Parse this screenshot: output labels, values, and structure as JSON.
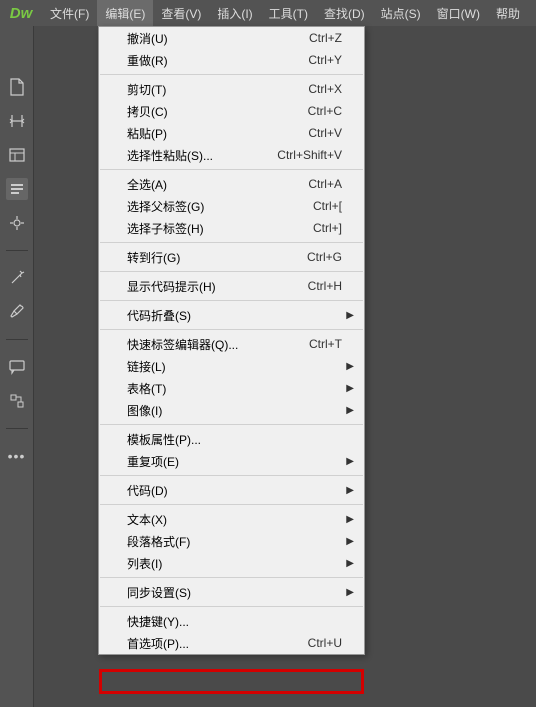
{
  "logo": "Dw",
  "menubar": [
    "文件(F)",
    "编辑(E)",
    "查看(V)",
    "插入(I)",
    "工具(T)",
    "查找(D)",
    "站点(S)",
    "窗口(W)",
    "帮助"
  ],
  "active_menu_index": 1,
  "dropdown": {
    "groups": [
      [
        {
          "label": "撤消(U)",
          "shortcut": "Ctrl+Z"
        },
        {
          "label": "重做(R)",
          "shortcut": "Ctrl+Y"
        }
      ],
      [
        {
          "label": "剪切(T)",
          "shortcut": "Ctrl+X"
        },
        {
          "label": "拷贝(C)",
          "shortcut": "Ctrl+C"
        },
        {
          "label": "粘贴(P)",
          "shortcut": "Ctrl+V"
        },
        {
          "label": "选择性粘贴(S)...",
          "shortcut": "Ctrl+Shift+V"
        }
      ],
      [
        {
          "label": "全选(A)",
          "shortcut": "Ctrl+A"
        },
        {
          "label": "选择父标签(G)",
          "shortcut": "Ctrl+["
        },
        {
          "label": "选择子标签(H)",
          "shortcut": "Ctrl+]"
        }
      ],
      [
        {
          "label": "转到行(G)",
          "shortcut": "Ctrl+G"
        }
      ],
      [
        {
          "label": "显示代码提示(H)",
          "shortcut": "Ctrl+H"
        }
      ],
      [
        {
          "label": "代码折叠(S)",
          "submenu": true
        }
      ],
      [
        {
          "label": "快速标签编辑器(Q)...",
          "shortcut": "Ctrl+T"
        },
        {
          "label": "链接(L)",
          "submenu": true
        },
        {
          "label": "表格(T)",
          "submenu": true
        },
        {
          "label": "图像(I)",
          "submenu": true
        }
      ],
      [
        {
          "label": "模板属性(P)..."
        },
        {
          "label": "重复项(E)",
          "submenu": true
        }
      ],
      [
        {
          "label": "代码(D)",
          "submenu": true
        }
      ],
      [
        {
          "label": "文本(X)",
          "submenu": true
        },
        {
          "label": "段落格式(F)",
          "submenu": true
        },
        {
          "label": "列表(I)",
          "submenu": true
        }
      ],
      [
        {
          "label": "同步设置(S)",
          "submenu": true
        }
      ],
      [
        {
          "label": "快捷键(Y)..."
        },
        {
          "label": "首选项(P)...",
          "shortcut": "Ctrl+U",
          "highlighted": true
        }
      ]
    ]
  }
}
